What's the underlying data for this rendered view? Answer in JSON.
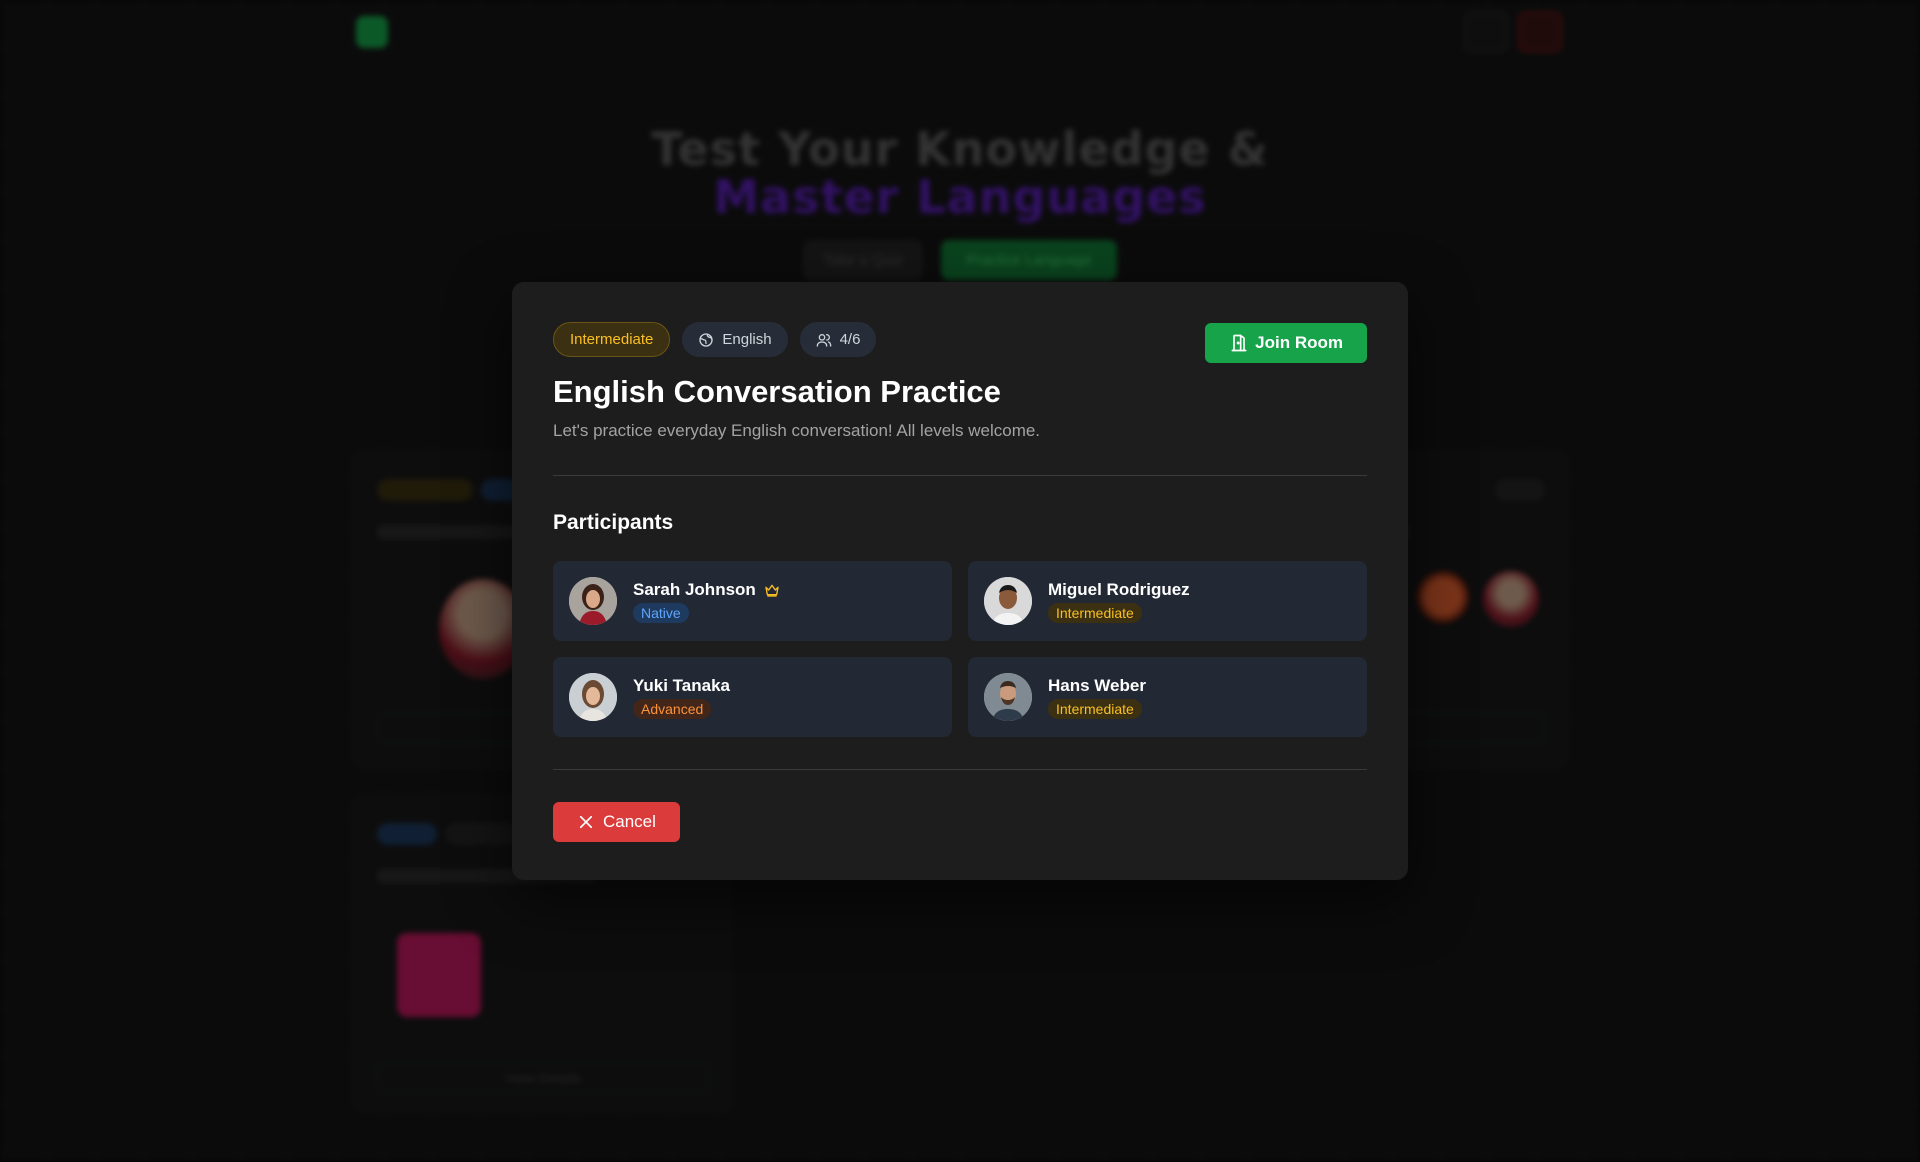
{
  "background": {
    "hero_line1": "Test Your Knowledge &",
    "hero_line2": "Master Languages",
    "take_quiz_label": "Take a Quiz",
    "practice_label": "Practice Language",
    "view_details_label": "View Details"
  },
  "modal": {
    "tags": {
      "level": "Intermediate",
      "language": "English",
      "capacity": "4/6"
    },
    "join_label": "Join Room",
    "title": "English Conversation Practice",
    "description": "Let's practice everyday English conversation! All levels welcome.",
    "participants_heading": "Participants",
    "participants": [
      {
        "name": "Sarah Johnson",
        "level": "Native",
        "host": true,
        "avatar": "woman-red-sweater"
      },
      {
        "name": "Miguel Rodriguez",
        "level": "Intermediate",
        "host": false,
        "avatar": "man-smiling"
      },
      {
        "name": "Yuki Tanaka",
        "level": "Advanced",
        "host": false,
        "avatar": "woman-smiling"
      },
      {
        "name": "Hans Weber",
        "level": "Intermediate",
        "host": false,
        "avatar": "man-beard"
      }
    ],
    "cancel_label": "Cancel"
  },
  "colors": {
    "accent_green": "#16a34a",
    "danger_red": "#dc3b3b",
    "level_intermediate": "#fbbf24",
    "level_native": "#60a5fa",
    "level_advanced": "#fb923c"
  }
}
